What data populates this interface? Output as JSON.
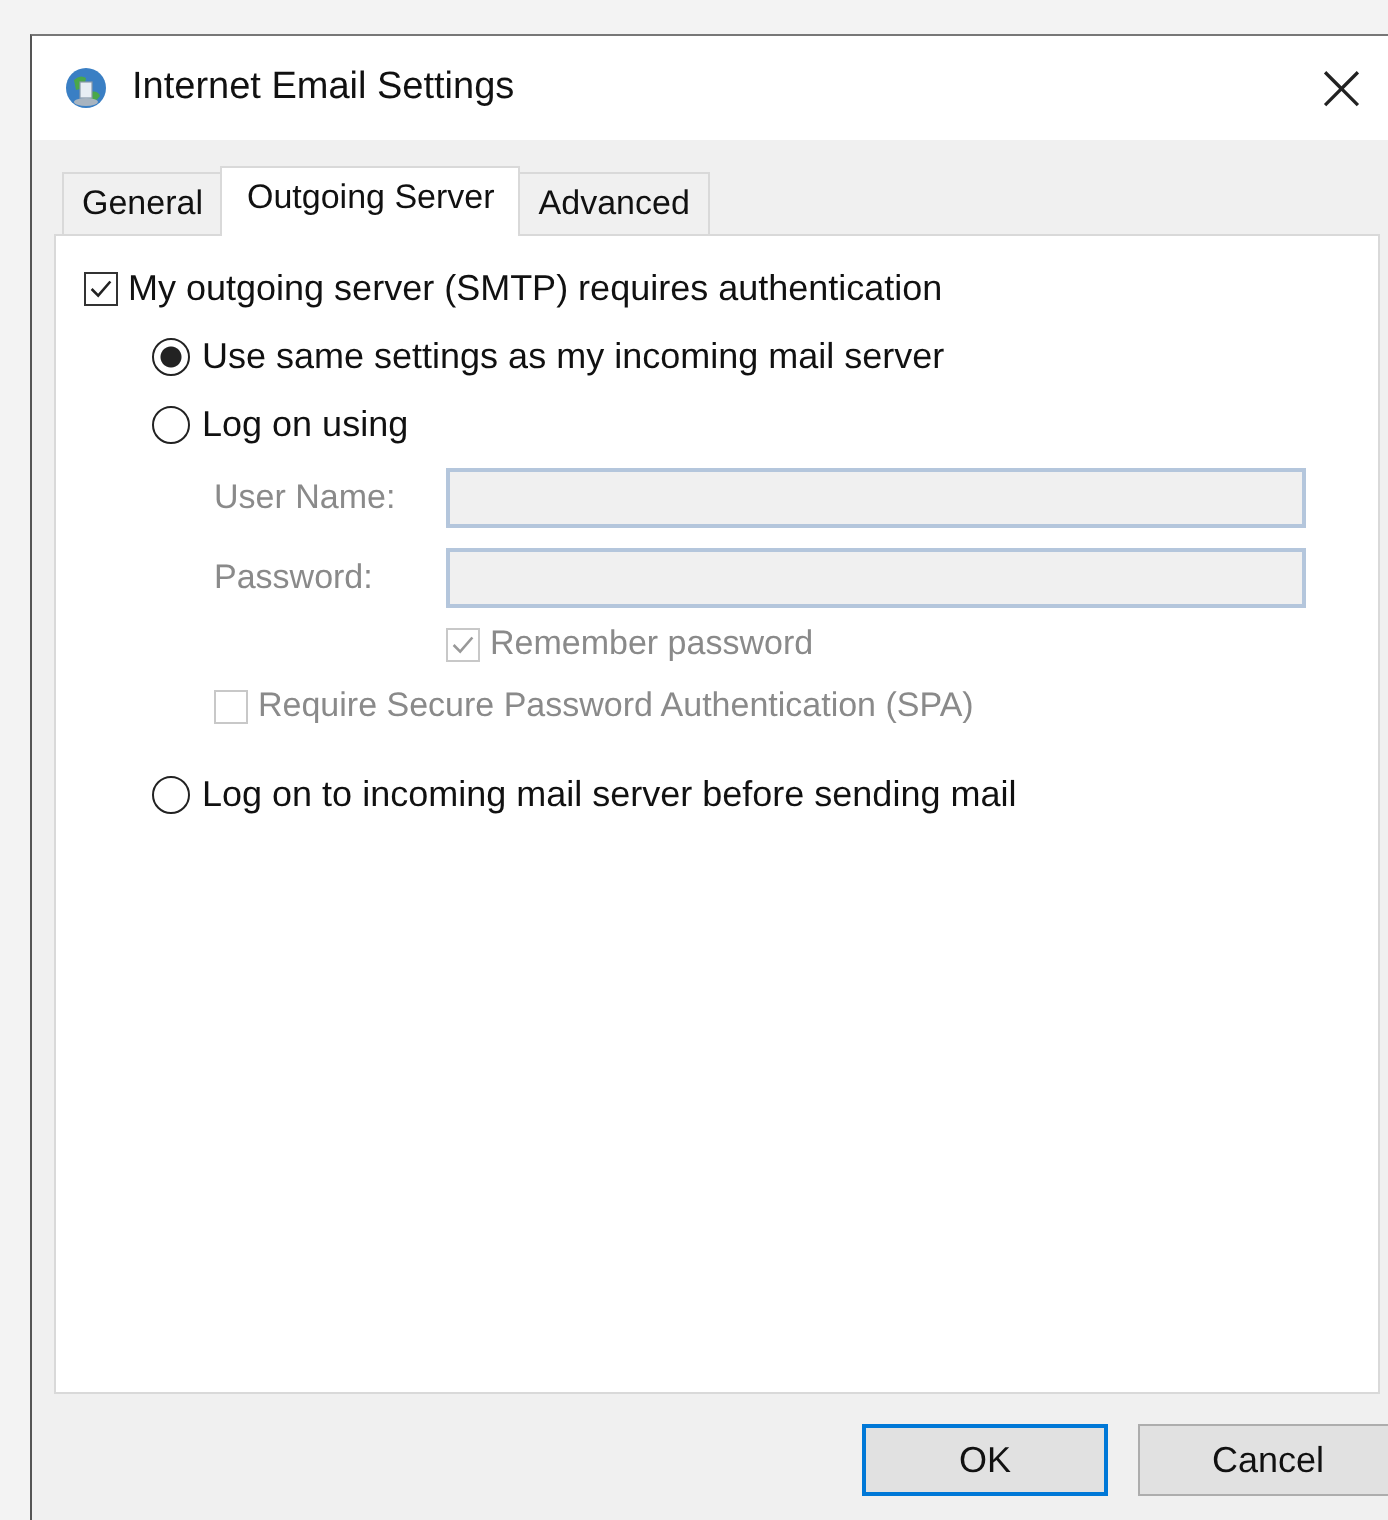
{
  "window": {
    "title": "Internet Email Settings",
    "close": "×"
  },
  "tabs": [
    {
      "label": "General",
      "selected": false
    },
    {
      "label": "Outgoing Server",
      "selected": true
    },
    {
      "label": "Advanced",
      "selected": false
    }
  ],
  "auth": {
    "label": "My outgoing server (SMTP) requires authentication",
    "checked": true
  },
  "options": [
    {
      "label": "Use same settings as my incoming mail server",
      "selected": true,
      "kind": "plain"
    },
    {
      "label": "Log on using",
      "selected": false,
      "kind": "logon"
    },
    {
      "label": "Log on to incoming mail server before sending mail",
      "selected": false,
      "kind": "plain"
    }
  ],
  "fields": [
    {
      "label": "User Name:",
      "disabled": true
    },
    {
      "label": "Password:",
      "disabled": true
    }
  ],
  "remember": {
    "label": "Remember password",
    "checked": true,
    "disabled": true
  },
  "spa": {
    "label": "Require Secure Password Authentication (SPA)",
    "checked": false,
    "disabled": true
  },
  "buttons": [
    {
      "label": "OK",
      "default": true
    },
    {
      "label": "Cancel",
      "default": false
    }
  ]
}
